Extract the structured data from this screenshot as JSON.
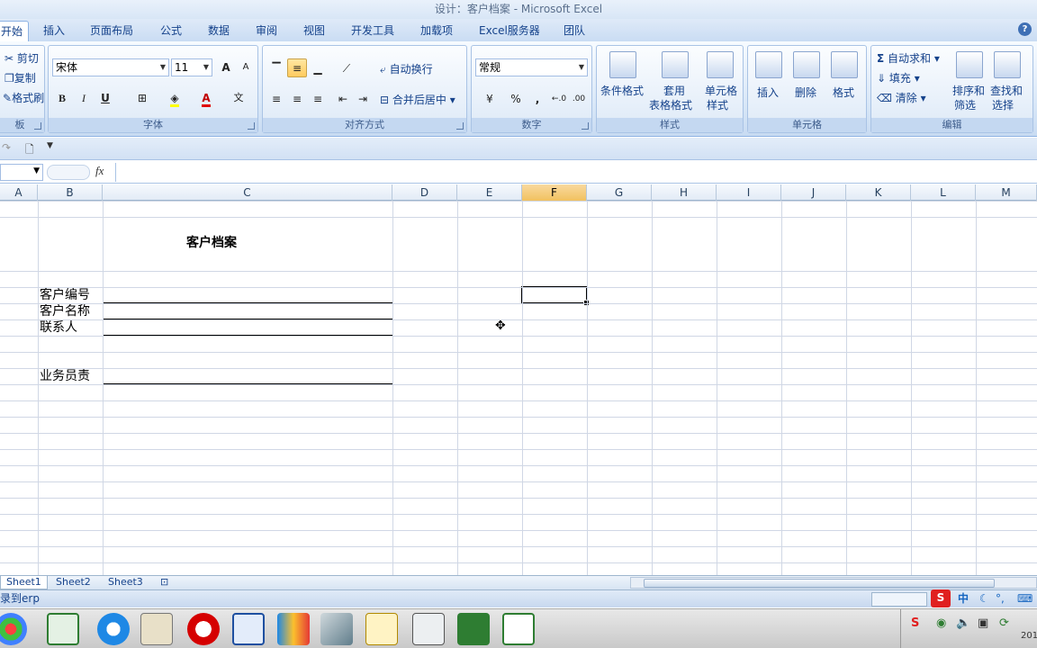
{
  "window": {
    "title": "设计：客户档案 - Microsoft Excel"
  },
  "tabs": [
    "开始",
    "插入",
    "页面布局",
    "公式",
    "数据",
    "审阅",
    "视图",
    "开发工具",
    "加载项",
    "Excel服务器",
    "团队"
  ],
  "help_icon": "?",
  "ribbon": {
    "clipboard": {
      "label": "板",
      "cut": "剪切",
      "copy": "复制",
      "format_painter": "格式刷"
    },
    "font": {
      "label": "字体",
      "font_name": "宋体",
      "font_size": "11",
      "bold": "B",
      "italic": "I",
      "underline": "U",
      "grow": "A",
      "shrink": "A",
      "font_color": "A",
      "phonetic": "文"
    },
    "alignment": {
      "label": "对齐方式",
      "wrap_text": "自动换行",
      "merge_center": "合并后居中"
    },
    "number": {
      "label": "数字",
      "format": "常规",
      "percent": "%",
      "comma": ",",
      "inc_decimal": "←.0",
      "dec_decimal": ".00"
    },
    "styles": {
      "label": "样式",
      "conditional": "条件格式",
      "table_line1": "套用",
      "table_line2": "表格格式",
      "cell_style_line1": "单元格",
      "cell_style_line2": "样式"
    },
    "cells": {
      "label": "单元格",
      "insert": "插入",
      "delete": "删除",
      "format": "格式"
    },
    "editing": {
      "label": "编辑",
      "autosum": "自动求和",
      "fill": "填充",
      "clear": "清除",
      "sort_line1": "排序和",
      "sort_line2": "筛选",
      "find_line1": "查找和",
      "find_line2": "选择"
    }
  },
  "formula_bar": {
    "fx": "fx",
    "value": ""
  },
  "columns": [
    "A",
    "B",
    "C",
    "D",
    "E",
    "F",
    "G",
    "H",
    "I",
    "J",
    "K",
    "L",
    "M"
  ],
  "selected_column": "F",
  "cells": {
    "title": "客户档案",
    "customer_no": "客户编号",
    "customer_name": "客户名称",
    "contact": "联系人",
    "sales_rep": "业务员责"
  },
  "sheets": [
    "Sheet1",
    "Sheet2",
    "Sheet3"
  ],
  "status": {
    "text": "录到erp"
  },
  "ime": {
    "s_logo": "S",
    "zh": "中",
    "moon": "☾",
    "punct": "°,",
    "keyboard": "⌨"
  },
  "tray": {
    "year": "201"
  },
  "colors": {
    "accent": "#15428b",
    "ribbon_bg": "#d7e6f7",
    "selection": "#f1c15f"
  }
}
